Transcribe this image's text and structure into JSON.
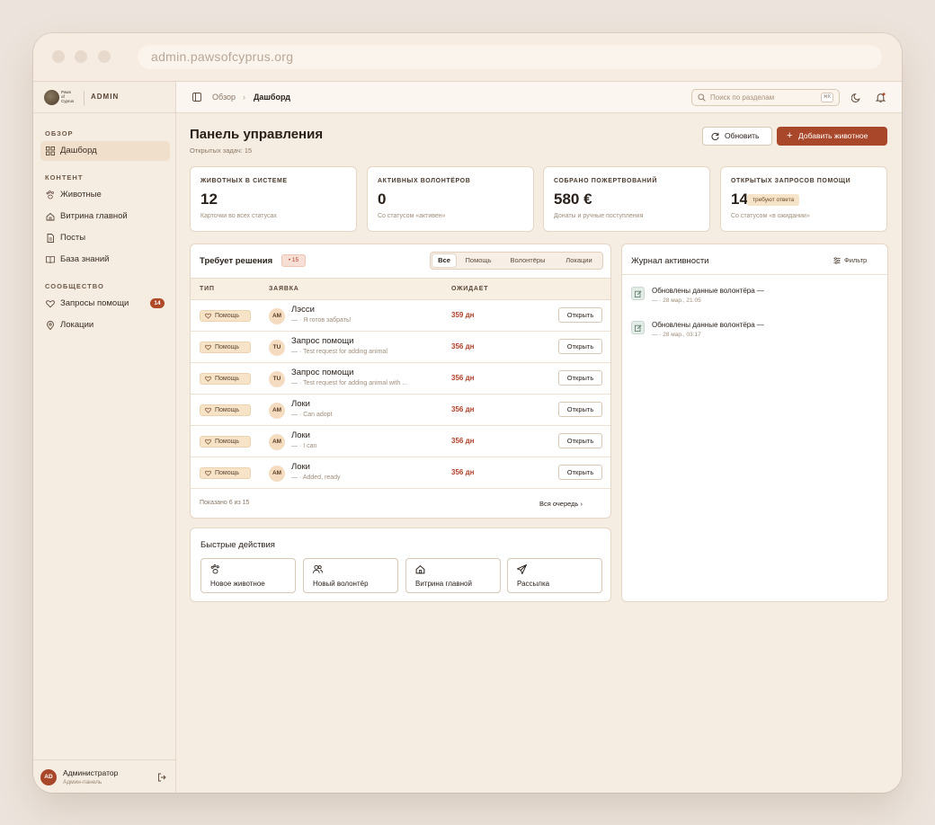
{
  "browser": {
    "url": "admin.pawsofcyprus.org"
  },
  "brand": {
    "logo_text": "Paws of Cyprus",
    "admin_label": "ADMIN"
  },
  "sidebar": {
    "sections": [
      {
        "title": "ОБЗОР"
      },
      {
        "title": "КОНТЕНТ"
      },
      {
        "title": "СООБЩЕСТВО"
      }
    ],
    "items": [
      {
        "label": "Дашборд",
        "icon": "grid-icon"
      },
      {
        "label": "Животные",
        "icon": "paw-icon"
      },
      {
        "label": "Витрина главной",
        "icon": "home-icon"
      },
      {
        "label": "Посты",
        "icon": "file-icon"
      },
      {
        "label": "База знаний",
        "icon": "book-icon"
      },
      {
        "label": "Запросы помощи",
        "icon": "heart-icon",
        "badge": "14"
      },
      {
        "label": "Локации",
        "icon": "location-icon"
      }
    ],
    "user": {
      "initials": "AD",
      "name": "Администратор",
      "role": "Админ-панель"
    }
  },
  "topbar": {
    "breadcrumb": [
      "Обзор",
      "Дашборд"
    ],
    "search_placeholder": "Поиск по разделам",
    "shortcut": "⌘K"
  },
  "header": {
    "title": "Панель управления",
    "subtitle": "Открытых задач: 15",
    "refresh_label": "Обновить",
    "add_label": "Добавить животное"
  },
  "stats": [
    {
      "label": "ЖИВОТНЫХ В СИСТЕМЕ",
      "value": "12",
      "hint": "Карточки во всех статусах"
    },
    {
      "label": "АКТИВНЫХ ВОЛОНТЁРОВ",
      "value": "0",
      "hint": "Со статусом «активен»"
    },
    {
      "label": "СОБРАНО ПОЖЕРТВОВАНИЙ",
      "value": "580 €",
      "hint": "Донаты и ручные поступления"
    },
    {
      "label": "ОТКРЫТЫХ ЗАПРОСОВ ПОМОЩИ",
      "value": "14",
      "badge": "требуют ответа",
      "hint": "Со статусом «в ожидании»"
    }
  ],
  "queue": {
    "title": "Требует решения",
    "count": "• 15",
    "filters": [
      "Все",
      "Помощь",
      "Волонтёры",
      "Локации"
    ],
    "columns": [
      "ТИП",
      "ЗАЯВКА",
      "ОЖИДАЕТ"
    ],
    "rows": [
      {
        "type": "Помощь",
        "initials": "AM",
        "title": "Лэсси",
        "sub": "— · Я готов забрать!",
        "wait": "359 дн",
        "action": "Открыть"
      },
      {
        "type": "Помощь",
        "initials": "TU",
        "title": "Запрос помощи",
        "sub": "— · Test request for adding animal",
        "wait": "356 дн",
        "action": "Открыть"
      },
      {
        "type": "Помощь",
        "initials": "TU",
        "title": "Запрос помощи",
        "sub": "— · Test request for adding animal with ...",
        "wait": "356 дн",
        "action": "Открыть"
      },
      {
        "type": "Помощь",
        "initials": "AM",
        "title": "Локи",
        "sub": "— · Can adopt",
        "wait": "356 дн",
        "action": "Открыть"
      },
      {
        "type": "Помощь",
        "initials": "AM",
        "title": "Локи",
        "sub": "— · I can",
        "wait": "356 дн",
        "action": "Открыть"
      },
      {
        "type": "Помощь",
        "initials": "AM",
        "title": "Локи",
        "sub": "— · Added, ready",
        "wait": "356 дн",
        "action": "Открыть"
      }
    ],
    "footer_left": "Показано 6 из 15",
    "footer_right": "Вся очередь ›"
  },
  "quick_actions": {
    "title": "Быстрые действия",
    "items": [
      {
        "label": "Новое животное",
        "icon": "paw-icon"
      },
      {
        "label": "Новый волонтёр",
        "icon": "users-icon"
      },
      {
        "label": "Витрина главной",
        "icon": "home-icon"
      },
      {
        "label": "Рассылка",
        "icon": "send-icon"
      }
    ]
  },
  "activity": {
    "title": "Журнал активности",
    "filter_label": "Фильтр",
    "items": [
      {
        "text": "Обновлены данные волонтёра —",
        "time": "— · 28 мар., 21:05"
      },
      {
        "text": "Обновлены данные волонтёра —",
        "time": "— · 28 мар., 03:17"
      }
    ]
  },
  "colors": {
    "accent": "#a9472a",
    "background": "#f6ede2",
    "danger": "#b0402a"
  }
}
